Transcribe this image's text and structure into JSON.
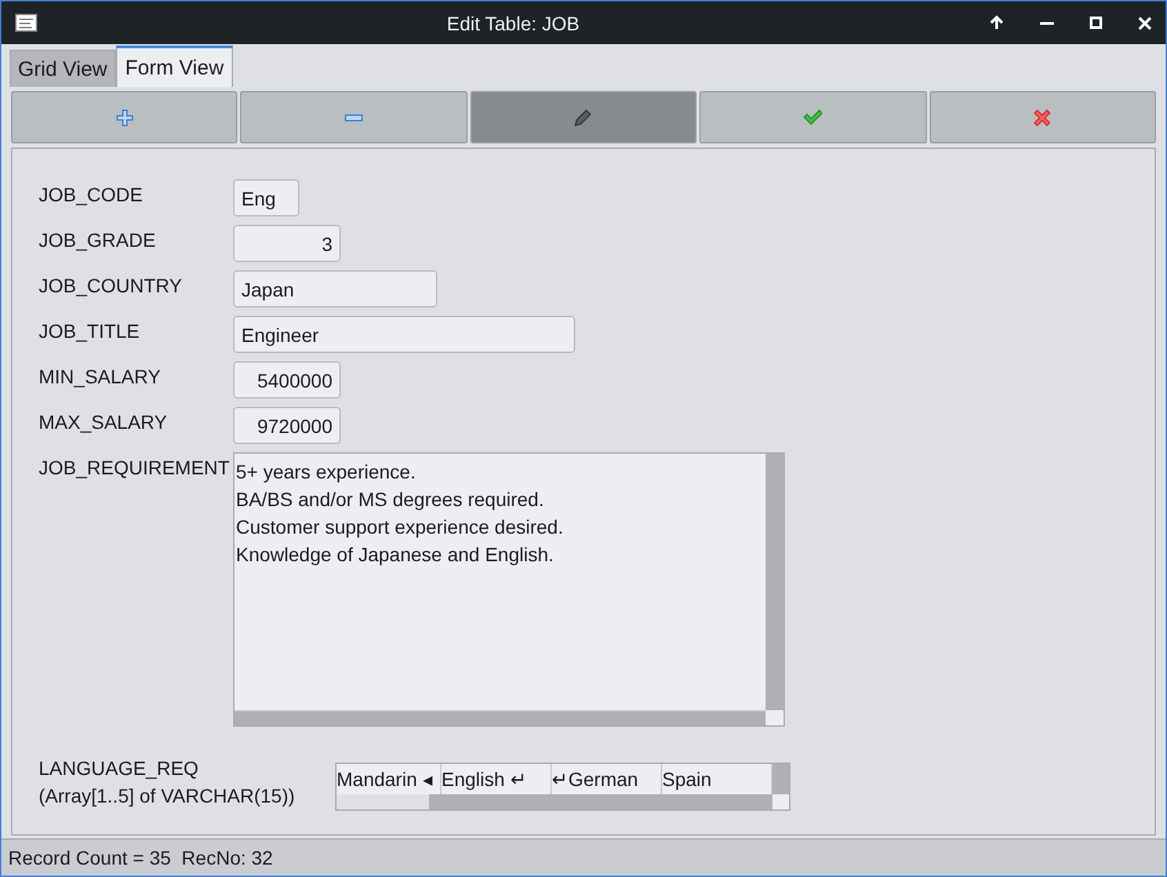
{
  "window": {
    "title": "Edit Table: JOB"
  },
  "tabs": [
    {
      "label": "Grid View",
      "selected": false
    },
    {
      "label": "Form View",
      "selected": true
    }
  ],
  "toolbar": [
    {
      "kind": "add",
      "active": false
    },
    {
      "kind": "remove",
      "active": false
    },
    {
      "kind": "edit",
      "active": true
    },
    {
      "kind": "post",
      "active": false
    },
    {
      "kind": "cancel",
      "active": false
    }
  ],
  "fields": [
    {
      "label": "JOB_CODE",
      "value": "Eng",
      "kind": "text"
    },
    {
      "label": "JOB_GRADE",
      "value": "3",
      "kind": "number"
    },
    {
      "label": "JOB_COUNTRY",
      "value": "Japan",
      "kind": "text"
    },
    {
      "label": "JOB_TITLE",
      "value": "Engineer",
      "kind": "text"
    },
    {
      "label": "MIN_SALARY",
      "value": "5400000",
      "kind": "number"
    },
    {
      "label": "MAX_SALARY",
      "value": "9720000",
      "kind": "number"
    }
  ],
  "requirement": {
    "label": "JOB_REQUIREMENT",
    "lines": [
      "5+ years experience.",
      "BA/BS and/or MS degrees required.",
      "Customer support experience desired.",
      "Knowledge of Japanese and English."
    ]
  },
  "language": {
    "label": "LANGUAGE_REQ",
    "sublabel": "(Array[1..5] of VARCHAR(15))",
    "cells": [
      "Mandarin ◂",
      "English ↵",
      "↵German",
      "Spain"
    ]
  },
  "status_bar": {
    "text": "Record Count = 35  RecNo: 32"
  }
}
